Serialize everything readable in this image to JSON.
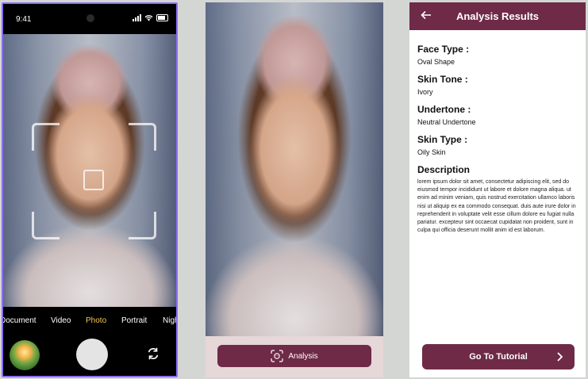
{
  "screen1": {
    "status_time": "9:41",
    "modes": [
      "Document",
      "Video",
      "Photo",
      "Portrait",
      "Night"
    ],
    "active_mode": "Photo",
    "icons": {
      "gallery": "gallery-thumbnail",
      "shutter": "shutter-button",
      "switch": "camera-switch-icon"
    }
  },
  "screen2": {
    "analysis_label": "Analysis",
    "icon": "face-scan-icon"
  },
  "screen3": {
    "title": "Analysis Results",
    "face_type_label": "Face Type :",
    "face_type_value": "Oval Shape",
    "skin_tone_label": "Skin Tone :",
    "skin_tone_value": "Ivory",
    "undertone_label": "Undertone :",
    "undertone_value": "Neutral Undertone",
    "skin_type_label": "Skin Type :",
    "skin_type_value": "Oily Skin",
    "description_label": "Description",
    "description_text": "lorem ipsum dolor sit amet, consectetur adipiscing elit, sed do eiusmod tempor incididunt ut labore et dolore magna aliqua. ut enim ad minim veniam, quis nostrud exercitation ullamco laboris nisi ut aliquip ex ea commodo consequat. duis aute irure dolor in reprehenderit in voluptate velit esse cillum dolore eu fugiat nulla pariatur. excepteur sint occaecat cupidatat non proident, sunt in culpa qui officia deserunt mollit anim id est laborum.",
    "tutorial_label": "Go To Tutorial"
  },
  "colors": {
    "accent": "#6e2a46",
    "active_mode": "#f3c64a",
    "frame_border": "#8b6cf2"
  }
}
